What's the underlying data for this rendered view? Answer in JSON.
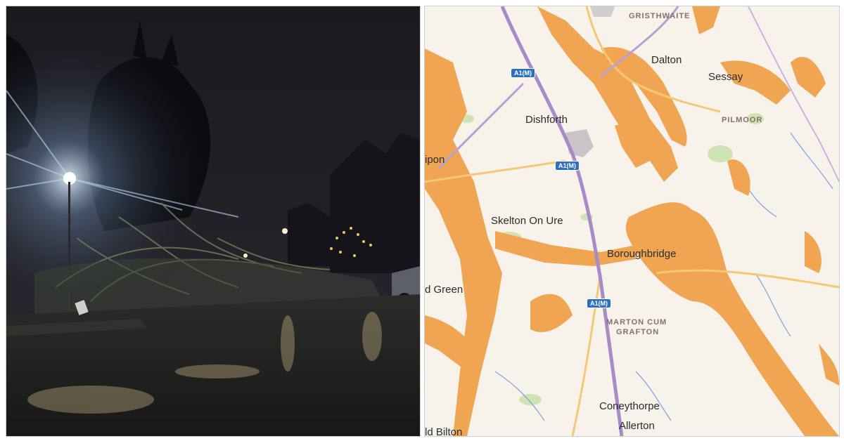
{
  "map": {
    "places": {
      "gristhwaite": "GRISTHWAITE",
      "dalton": "Dalton",
      "sessay": "Sessay",
      "dishforth": "Dishforth",
      "pilmoor": "PILMOOR",
      "ripon": "ipon",
      "skelton": "Skelton On Ure",
      "boroughbridge": "Boroughbridge",
      "green": "d Green",
      "marton": "MARTON CUM",
      "grafton": "GRAFTON",
      "coneythorpe": "Coneythorpe",
      "allerton": "Allerton",
      "bilton": "ld Bilton"
    },
    "road_shield": "A1(M)",
    "colors": {
      "background": "#f7f3ea",
      "flood_zone": "#f0a553",
      "motorway": "#a98ac8",
      "a_road": "#f3c877",
      "water": "#7fa8e0",
      "green_space": "#cfe3b5"
    }
  },
  "photo": {
    "colors": {
      "sky": "#1d1a22",
      "street_light": "#dfefff",
      "wet_road": "#3a3c38"
    }
  }
}
